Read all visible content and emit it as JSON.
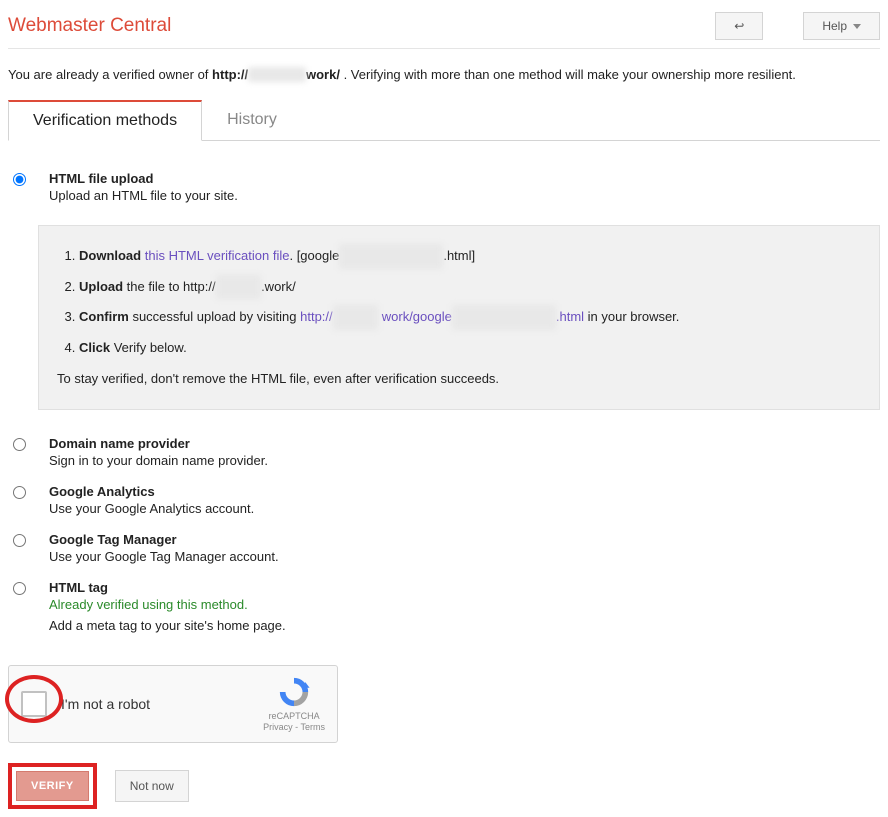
{
  "header": {
    "title": "Webmaster Central",
    "back_label": "↩",
    "help_label": "Help"
  },
  "intro": {
    "prefix": "You are already a verified owner of ",
    "url_prefix": "http://",
    "url_redacted": "xxxxxxxx",
    "url_suffix": "work/",
    "suffix": ". Verifying with more than one method will make your ownership more resilient."
  },
  "tabs": {
    "verification": "Verification methods",
    "history": "History"
  },
  "methods": {
    "html_file": {
      "title": "HTML file upload",
      "desc": "Upload an HTML file to your site.",
      "steps": {
        "s1_label": "Download",
        "s1_link": "this HTML verification file",
        "s1_suffix_open": ". [google",
        "s1_redacted": "xxxxxxxxxxxxxxxx",
        "s1_suffix_close": ".html]",
        "s2_label": "Upload",
        "s2_text": " the file to http://",
        "s2_redacted": "xxxxxxx",
        "s2_suffix": ".work/",
        "s3_label": "Confirm",
        "s3_text": " successful upload by visiting ",
        "s3_link_pre": "http://",
        "s3_link_red1": "xxxxxxx",
        "s3_link_mid": " work/google",
        "s3_link_red2": "xxxxxxxxxxxxxxxx",
        "s3_link_suf": ".html",
        "s3_after": " in your browser.",
        "s4_label": "Click",
        "s4_text": " Verify below."
      },
      "note": "To stay verified, don't remove the HTML file, even after verification succeeds."
    },
    "domain": {
      "title": "Domain name provider",
      "desc": "Sign in to your domain name provider."
    },
    "analytics": {
      "title": "Google Analytics",
      "desc": "Use your Google Analytics account."
    },
    "gtm": {
      "title": "Google Tag Manager",
      "desc": "Use your Google Tag Manager account."
    },
    "html_tag": {
      "title": "HTML tag",
      "verified_msg": "Already verified using this method.",
      "extra": "Add a meta tag to your site's home page."
    }
  },
  "recaptcha": {
    "label": "I'm not a robot",
    "brand": "reCAPTCHA",
    "privacy": "Privacy",
    "terms": "Terms",
    "sep": " - "
  },
  "actions": {
    "verify": "VERIFY",
    "not_now": "Not now"
  }
}
